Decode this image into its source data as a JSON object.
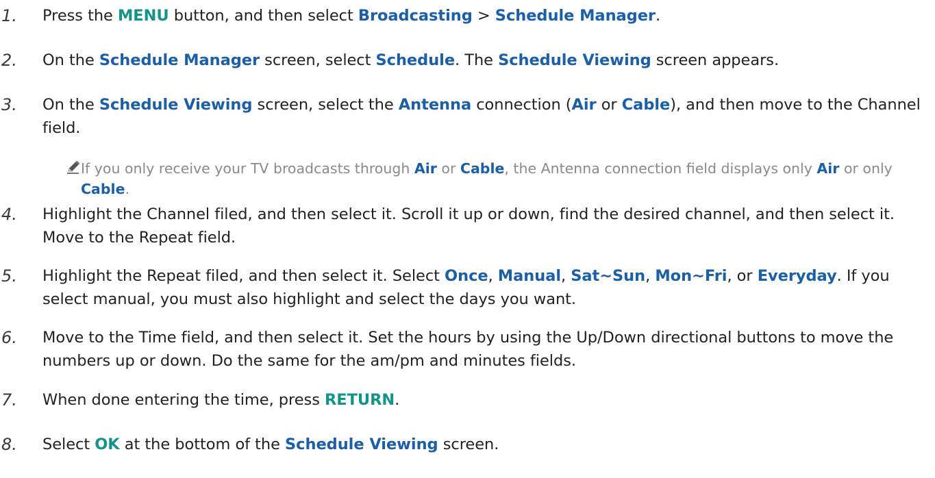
{
  "steps": [
    {
      "num": "1.",
      "parts": [
        {
          "t": "Press the "
        },
        {
          "t": "MENU",
          "c": "teal"
        },
        {
          "t": " button, and then select "
        },
        {
          "t": "Broadcasting",
          "c": "blue"
        },
        {
          "t": " > "
        },
        {
          "t": "Schedule Manager",
          "c": "blue"
        },
        {
          "t": "."
        }
      ]
    },
    {
      "num": "2.",
      "parts": [
        {
          "t": "On the "
        },
        {
          "t": "Schedule Manager",
          "c": "blue"
        },
        {
          "t": " screen, select "
        },
        {
          "t": "Schedule",
          "c": "blue"
        },
        {
          "t": ". The "
        },
        {
          "t": "Schedule Viewing",
          "c": "blue"
        },
        {
          "t": " screen appears."
        }
      ]
    },
    {
      "num": "3.",
      "parts": [
        {
          "t": "On the "
        },
        {
          "t": "Schedule Viewing",
          "c": "blue"
        },
        {
          "t": " screen, select the "
        },
        {
          "t": "Antenna",
          "c": "blue"
        },
        {
          "t": " connection ("
        },
        {
          "t": "Air",
          "c": "blue"
        },
        {
          "t": " or "
        },
        {
          "t": "Cable",
          "c": "blue"
        },
        {
          "t": "), and then move to the Channel field."
        }
      ]
    },
    {
      "num": "4.",
      "parts": [
        {
          "t": "Highlight the Channel filed, and then select it. Scroll it up or down, find the desired channel, and then select it. Move to the Repeat field."
        }
      ]
    },
    {
      "num": "5.",
      "parts": [
        {
          "t": "Highlight the Repeat filed, and then select it. Select "
        },
        {
          "t": "Once",
          "c": "blue"
        },
        {
          "t": ", "
        },
        {
          "t": "Manual",
          "c": "blue"
        },
        {
          "t": ", "
        },
        {
          "t": "Sat~Sun",
          "c": "blue"
        },
        {
          "t": ", "
        },
        {
          "t": "Mon~Fri",
          "c": "blue"
        },
        {
          "t": ", or "
        },
        {
          "t": "Everyday",
          "c": "blue"
        },
        {
          "t": ". If you select manual, you must also highlight and select the days you want."
        }
      ]
    },
    {
      "num": "6.",
      "parts": [
        {
          "t": "Move to the Time field, and then select it. Set the hours by using the Up/Down directional buttons to move the numbers up or down. Do the same for the am/pm and minutes fields."
        }
      ]
    },
    {
      "num": "7.",
      "parts": [
        {
          "t": "When done entering the time, press "
        },
        {
          "t": "RETURN",
          "c": "teal"
        },
        {
          "t": "."
        }
      ]
    },
    {
      "num": "8.",
      "parts": [
        {
          "t": "Select "
        },
        {
          "t": "OK",
          "c": "teal"
        },
        {
          "t": " at the bottom of the "
        },
        {
          "t": "Schedule Viewing",
          "c": "blue"
        },
        {
          "t": " screen."
        }
      ]
    }
  ],
  "note": {
    "icon": "pencil-icon",
    "parts": [
      {
        "t": "If you only receive your TV broadcasts through "
      },
      {
        "t": "Air",
        "c": "blue"
      },
      {
        "t": " or "
      },
      {
        "t": "Cable",
        "c": "blue"
      },
      {
        "t": ", the Antenna connection field displays only "
      },
      {
        "t": "Air",
        "c": "blue"
      },
      {
        "t": " or only "
      },
      {
        "t": "Cable",
        "c": "blue"
      },
      {
        "t": "."
      }
    ]
  },
  "colors": {
    "teal": "#139489",
    "blue": "#1a5fa8",
    "note_text": "#8a8a8a"
  }
}
